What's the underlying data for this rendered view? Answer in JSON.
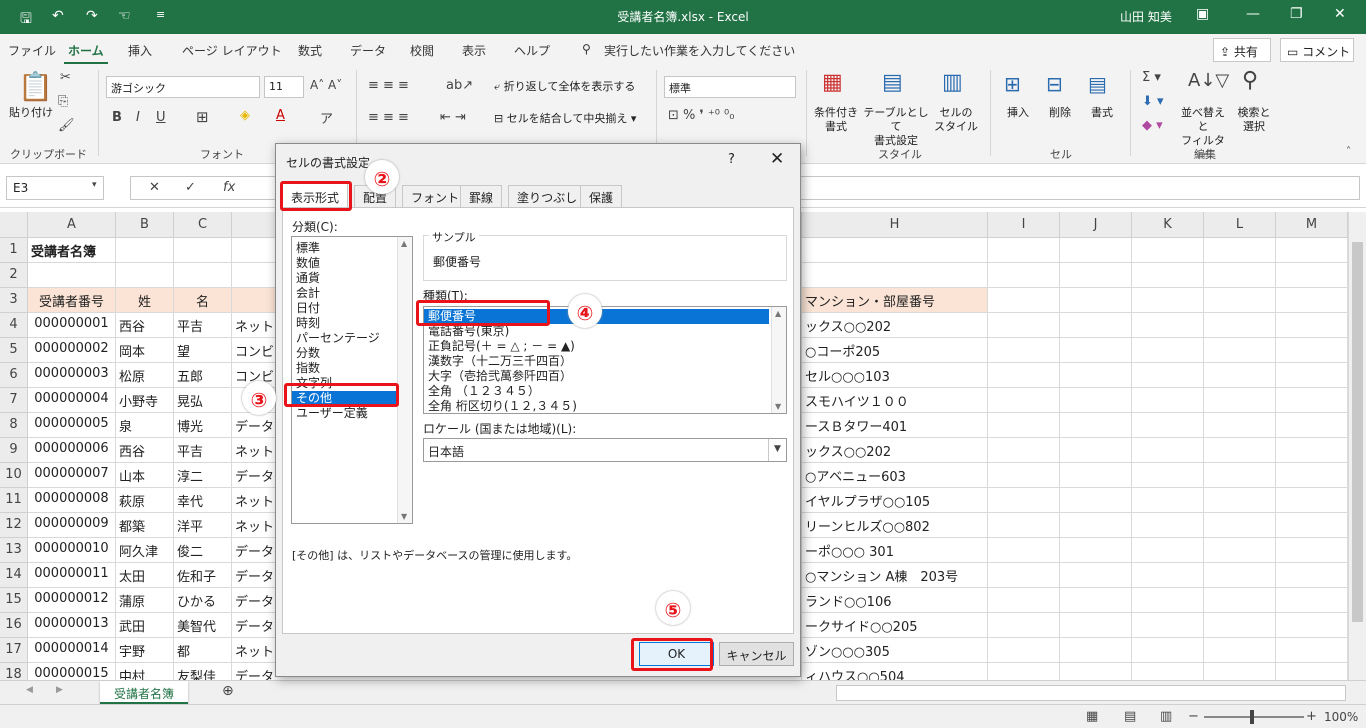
{
  "titlebar": {
    "title": "受講者名簿.xlsx  -  Excel",
    "user": "山田 知美"
  },
  "menu": {
    "tabs": [
      "ファイル",
      "ホーム",
      "挿入",
      "ページ レイアウト",
      "数式",
      "データ",
      "校閲",
      "表示",
      "ヘルプ"
    ],
    "active_tab": "ホーム",
    "tell_me": "実行したい作業を入力してください",
    "share": "共有",
    "comment": "コメント"
  },
  "ribbon": {
    "paste": "貼り付け",
    "clipboard": "クリップボード",
    "font_name": "游ゴシック",
    "font_size": "11",
    "font_group": "フォント",
    "wrap_text": "折り返して全体を表示する",
    "merge_center": "セルを結合して中央揃え",
    "number_format": "標準",
    "cond_format": "条件付き",
    "cond_format2": "書式",
    "table_format": "テーブルとして",
    "table_format2": "書式設定",
    "cell_style": "セルの",
    "cell_style2": "スタイル",
    "style_group": "スタイル",
    "insert": "挿入",
    "delete": "削除",
    "format": "書式",
    "cells_group": "セル",
    "sort_filter": "並べ替えと",
    "sort_filter2": "フィルター",
    "find_select": "検索と",
    "find_select2": "選択",
    "edit_group": "編集"
  },
  "formula_bar": {
    "name_box": "E3",
    "fx": "fx"
  },
  "sheet": {
    "columns": [
      "A",
      "B",
      "C",
      "",
      "",
      "",
      "",
      "H",
      "I",
      "J",
      "K",
      "L",
      "M"
    ],
    "rows": [
      "1",
      "2",
      "3",
      "4",
      "5",
      "6",
      "7",
      "8",
      "9",
      "10",
      "11",
      "12",
      "13",
      "14",
      "15",
      "16",
      "17",
      "18"
    ],
    "title": "受講者名簿",
    "header": [
      "受講者番号",
      "姓",
      "名",
      "マンション・部屋番号"
    ],
    "data": [
      [
        "000000001",
        "西谷",
        "平吉",
        "ネット",
        "ックス○○202"
      ],
      [
        "000000002",
        "岡本",
        "望",
        "コンビ",
        "○コーポ205"
      ],
      [
        "000000003",
        "松原",
        "五郎",
        "コンビ",
        "セル○○○103"
      ],
      [
        "000000004",
        "小野寺",
        "晃弘",
        "",
        "スモハイツ１００"
      ],
      [
        "000000005",
        "泉",
        "博光",
        "データ",
        "ースＢタワー401"
      ],
      [
        "000000006",
        "西谷",
        "平吉",
        "ネット",
        "ックス○○202"
      ],
      [
        "000000007",
        "山本",
        "淳二",
        "データ",
        "○アベニュー603"
      ],
      [
        "000000008",
        "萩原",
        "幸代",
        "ネット",
        "イヤルプラザ○○105"
      ],
      [
        "000000009",
        "都築",
        "洋平",
        "ネット",
        "リーンヒルズ○○802"
      ],
      [
        "000000010",
        "阿久津",
        "俊二",
        "データ",
        "ーポ○○○ 301"
      ],
      [
        "000000011",
        "太田",
        "佐和子",
        "データ",
        "○マンション A棟　203号"
      ],
      [
        "000000012",
        "蒲原",
        "ひかる",
        "データ",
        "ランド○○106"
      ],
      [
        "000000013",
        "武田",
        "美智代",
        "データ",
        "ークサイド○○205"
      ],
      [
        "000000014",
        "宇野",
        "都",
        "ネット",
        "ゾン○○○305"
      ],
      [
        "000000015",
        "中村",
        "友梨佳",
        "データ",
        "ィハウス○○504"
      ]
    ]
  },
  "sheet_tab": "受講者名簿",
  "zoom": "100%",
  "dialog": {
    "title": "セルの書式設定",
    "help": "?",
    "close": "✕",
    "tabs": [
      "表示形式",
      "配置",
      "フォント",
      "罫線",
      "塗りつぶし",
      "保護"
    ],
    "category_label": "分類(C):",
    "categories": [
      "標準",
      "数値",
      "通貨",
      "会計",
      "日付",
      "時刻",
      "パーセンテージ",
      "分数",
      "指数",
      "文字列",
      "その他",
      "ユーザー定義"
    ],
    "selected_category": "その他",
    "sample_label": "サンプル",
    "sample_value": "郵便番号",
    "type_label": "種類(T):",
    "types": [
      "郵便番号",
      "電話番号(東京)",
      "正負記号(＋ = △ ; － = ▲)",
      "漢数字（十二万三千四百）",
      "大字（壱拾弐萬参阡四百）",
      "全角 （１２３４５）",
      "全角 桁区切り(１２,３４５)"
    ],
    "selected_type": "郵便番号",
    "locale_label": "ロケール (国または地域)(L):",
    "locale_value": "日本語",
    "description": "[その他] は、リストやデータベースの管理に使用します。",
    "ok": "OK",
    "cancel": "キャンセル"
  },
  "steps": [
    "②",
    "③",
    "④",
    "⑤"
  ]
}
